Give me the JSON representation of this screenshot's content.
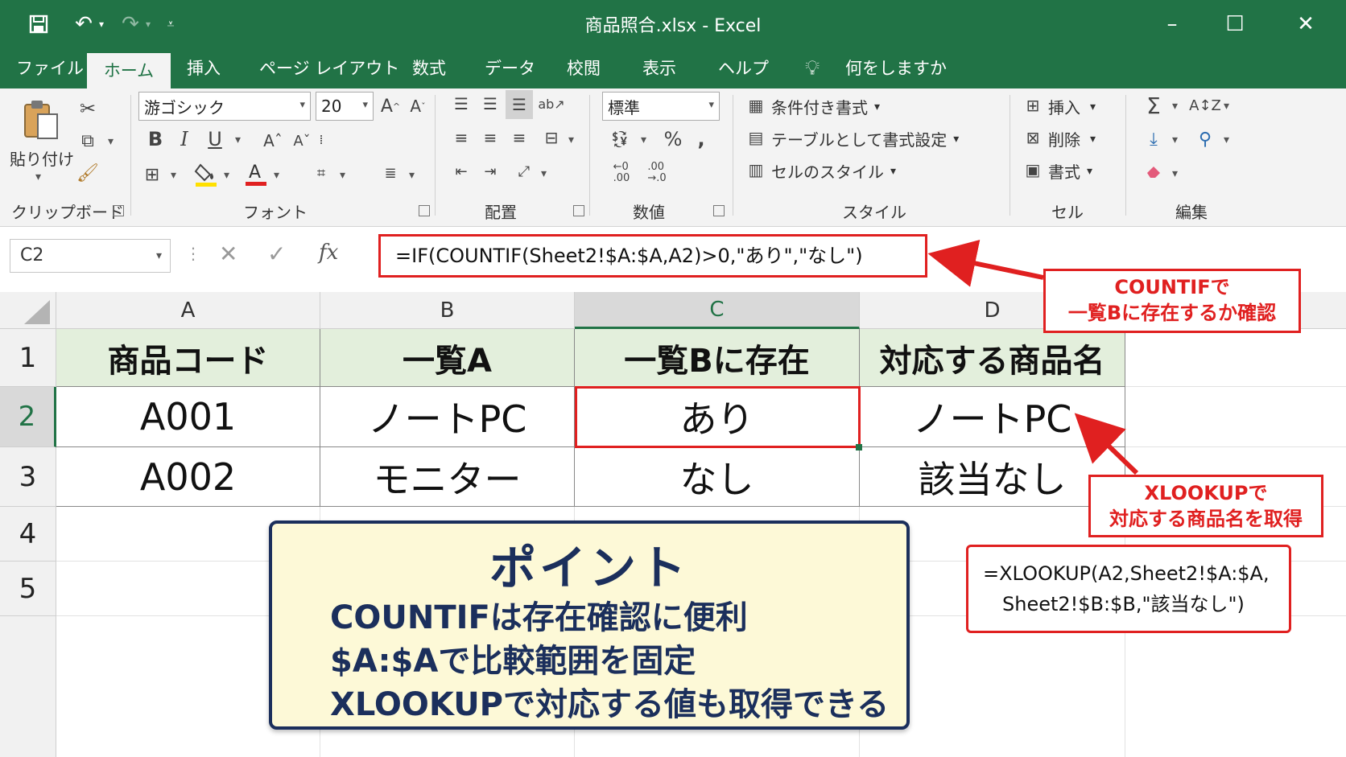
{
  "window": {
    "title": "商品照合.xlsx  -  Excel",
    "quick_access": {
      "save": "save-icon",
      "undo": "undo-icon",
      "redo": "redo-icon",
      "customize": "customize-icon"
    },
    "controls": {
      "minimize": "–",
      "maximize": "☐",
      "close": "✕"
    }
  },
  "tabs": [
    "ファイル",
    "ホーム",
    "挿入",
    "ページ レイアウト",
    "数式",
    "データ",
    "校閲",
    "表示",
    "ヘルプ"
  ],
  "active_tab": "ホーム",
  "tell_me": "何をしますか",
  "ribbon": {
    "clipboard": {
      "label": "クリップボード",
      "paste": "貼り付け"
    },
    "font": {
      "label": "フォント",
      "font_name": "游ゴシック",
      "font_size": "20"
    },
    "alignment": {
      "label": "配置"
    },
    "number": {
      "label": "数値",
      "format": "標準"
    },
    "styles": {
      "label": "スタイル",
      "conditional": "条件付き書式",
      "table": "テーブルとして書式設定",
      "cell_styles": "セルのスタイル"
    },
    "cells": {
      "label": "セル",
      "insert": "挿入",
      "delete": "削除",
      "format": "書式"
    },
    "editing": {
      "label": "編集"
    }
  },
  "formula_bar": {
    "name_box": "C2",
    "fx": "fx",
    "formula": "=IF(COUNTIF(Sheet2!$A:$A,A2)>0,\"あり\",\"なし\")"
  },
  "sheet": {
    "columns": [
      "A",
      "B",
      "C",
      "D"
    ],
    "rows": [
      "1",
      "2",
      "3",
      "4",
      "5"
    ],
    "header_row": [
      "商品コード",
      "一覧A",
      "一覧Bに存在",
      "対応する商品名"
    ],
    "data": [
      [
        "A001",
        "ノートPC",
        "あり",
        "ノートPC"
      ],
      [
        "A002",
        "モニター",
        "なし",
        "該当なし"
      ]
    ]
  },
  "annotations": {
    "countif_callout": [
      "COUNTIFで",
      "一覧Bに存在するか確認"
    ],
    "xlookup_callout": [
      "XLOOKUPで",
      "対応する商品名を取得"
    ],
    "xlookup_formula": [
      "=XLOOKUP(A2,Sheet2!$A:$A,",
      "Sheet2!$B:$B,\"該当なし\")"
    ],
    "point_title": "ポイント",
    "point_lines": [
      "COUNTIFは存在確認に便利",
      "$A:$Aで比較範囲を固定",
      "XLOOKUPで対応する値も取得できる"
    ],
    "accent_color": "#e02020",
    "point_color": "#1b2f5c"
  },
  "colors": {
    "excel_green": "#217346",
    "header_fill": "#e3efdc"
  }
}
